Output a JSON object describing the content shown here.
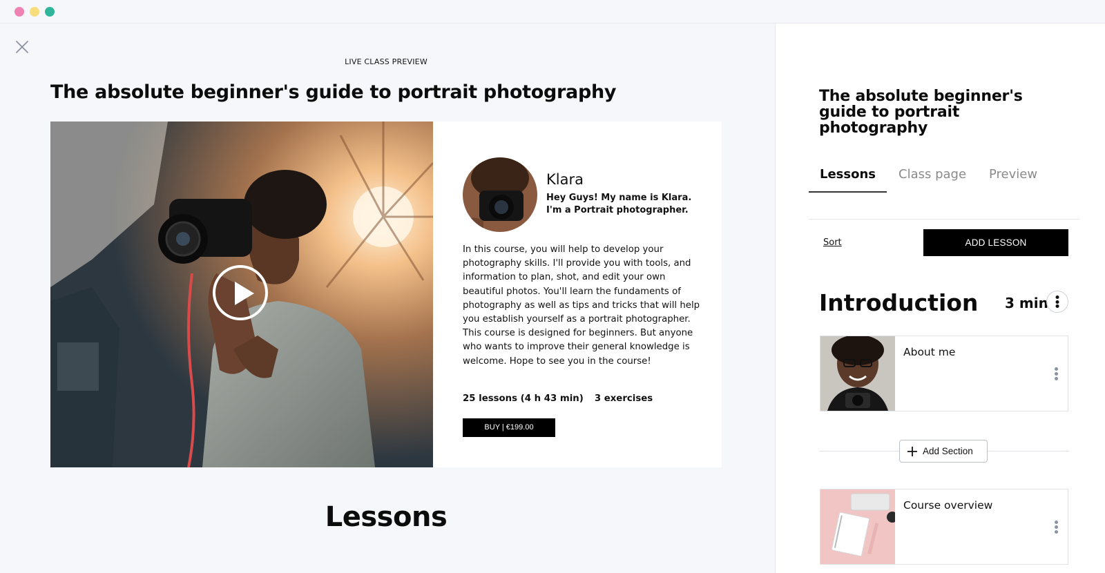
{
  "window": {
    "controls": [
      "close",
      "minimize",
      "maximize"
    ]
  },
  "preview": {
    "label": "LIVE CLASS PREVIEW",
    "title": "The absolute beginner's guide to portrait photography",
    "instructor": {
      "name": "Klara",
      "intro": "Hey Guys! My name is Klara. I'm a Portrait photographer."
    },
    "description": "In this course, you will help to develop your photography skills. I'll provide you with tools, and information to plan, shot, and edit your own beautiful photos. You'll learn the fundaments of photography as well as tips and tricks that will help you establish yourself as a portrait photographer. This course is designed for beginners. But anyone who wants to improve their general knowledge is welcome. Hope to see you in the course!",
    "stats": {
      "lessons": "25 lessons (4 h 43 min)",
      "exercises": "3 exercises"
    },
    "buy_label": "BUY | €199.00",
    "lessons_heading": "Lessons"
  },
  "side_panel": {
    "title": "The absolute beginner's guide to portrait photography",
    "tabs": [
      {
        "label": "Lessons",
        "active": true
      },
      {
        "label": "Class page",
        "active": false
      },
      {
        "label": "Preview",
        "active": false
      }
    ],
    "sort_label": "Sort",
    "add_lesson_label": "ADD LESSON",
    "section": {
      "title": "Introduction",
      "duration": "3 min"
    },
    "lessons": [
      {
        "name": "About me"
      },
      {
        "name": "Course overview"
      }
    ],
    "add_section_label": "Add Section"
  },
  "colors": {
    "accent": "#000000",
    "background": "#f6f7fa",
    "dot_red": "#ee82b3",
    "dot_yellow": "#f7dd7b",
    "dot_green": "#2fb59b"
  },
  "icons": [
    "close-icon",
    "play-icon",
    "more-vertical-icon",
    "plus-icon"
  ]
}
